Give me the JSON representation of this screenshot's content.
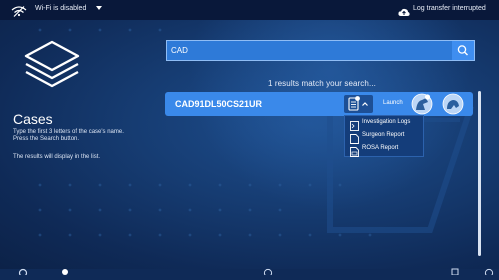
{
  "topbar": {
    "wifi_status": "Wi-Fi is disabled",
    "transfer_status": "Log transfer interrupted"
  },
  "sidebar": {
    "title": "Cases",
    "description": "Type the first 3 letters of the case's name. Press the Search button.",
    "note": "The results will display in the list."
  },
  "search": {
    "value": "CAD"
  },
  "results": {
    "summary": "1 results match your search...",
    "rows": [
      {
        "case_id": "CAD91DL50CS21UR",
        "launch_label": "Launch"
      }
    ]
  },
  "dropdown": {
    "items": [
      {
        "label": "Investigation Logs",
        "icon": "log-file-icon"
      },
      {
        "label": "Surgeon Report",
        "icon": "document-icon"
      },
      {
        "label": "ROSA Report",
        "icon": "report-icon"
      }
    ]
  },
  "colors": {
    "background": "#0f2a57",
    "topbar": "#09183a",
    "accent": "#3a89ea",
    "dropdown": "#143d7a"
  }
}
